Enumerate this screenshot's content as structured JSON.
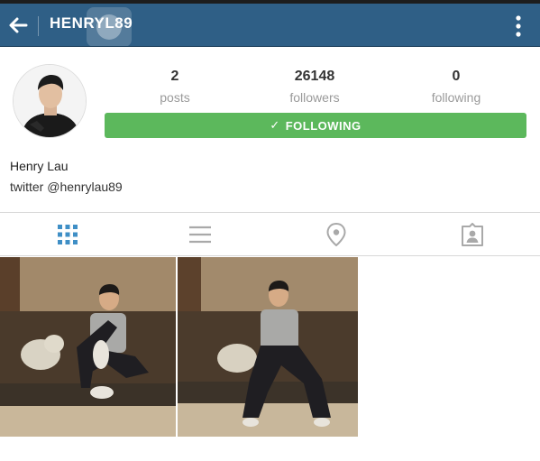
{
  "header": {
    "username": "HENRYL89",
    "icons": {
      "back": "arrow-left-icon",
      "more": "vertical-dots-icon"
    }
  },
  "profile": {
    "full_name": "Henry Lau",
    "bio": "twitter @henrylau89",
    "stats": {
      "posts": {
        "value": "2",
        "label": "posts"
      },
      "followers": {
        "value": "26148",
        "label": "followers"
      },
      "following": {
        "value": "0",
        "label": "following"
      }
    },
    "follow_button": {
      "label": "FOLLOWING",
      "icon": "checkmark-icon",
      "color": "#5cb85c"
    }
  },
  "tabs": [
    {
      "name": "grid",
      "icon": "grid-icon",
      "active": true
    },
    {
      "name": "list",
      "icon": "list-icon",
      "active": false
    },
    {
      "name": "places",
      "icon": "location-pin-icon",
      "active": false
    },
    {
      "name": "tagged",
      "icon": "tagged-person-icon",
      "active": false
    }
  ],
  "colors": {
    "topbar": "#2f5f86",
    "accent": "#3f8fc6",
    "follow_green": "#5cb85c",
    "inactive_icon": "#a9a9a9"
  }
}
